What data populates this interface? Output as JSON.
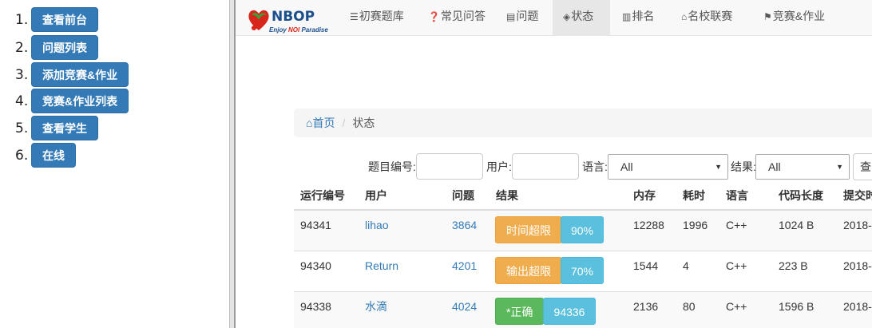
{
  "admin_menu": {
    "numbers": [
      "1.",
      "2.",
      "3.",
      "4.",
      "5.",
      "6."
    ],
    "items": [
      "查看前台",
      "问题列表",
      "添加竞赛&作业",
      "竞赛&作业列表",
      "查看学生",
      "在线"
    ]
  },
  "navbar": {
    "logo": {
      "brand": "NBOP",
      "tagline_pre": "Enjoy ",
      "tagline_noi": "NOI",
      "tagline_post": " Paradise"
    },
    "items": [
      {
        "icon": "list-icon",
        "glyph": "☰",
        "label": "初赛题库"
      },
      {
        "icon": "question-circle-icon",
        "glyph": "❓",
        "label": "常见问答"
      },
      {
        "icon": "list-alt-icon",
        "glyph": "▤",
        "label": "问题"
      },
      {
        "icon": "cube-icon",
        "glyph": "◈",
        "label": "状态"
      },
      {
        "icon": "bar-chart-icon",
        "glyph": "▥",
        "label": "排名"
      },
      {
        "icon": "bank-icon",
        "glyph": "⌂",
        "label": "名校联赛"
      },
      {
        "icon": "flag-icon",
        "glyph": "⚑",
        "label": "竞赛&作业"
      }
    ],
    "active_index": 3
  },
  "breadcrumb": {
    "home": "首页",
    "separator": "/",
    "current": "状态"
  },
  "filter": {
    "problem_id_label": "题目编号:",
    "user_label": "用户:",
    "language_label": "语言:",
    "language_value": "All",
    "result_label": "结果:",
    "result_value": "All",
    "query_label": "查"
  },
  "table": {
    "headers": [
      "运行编号",
      "用户",
      "问题",
      "结果",
      "内存",
      "耗时",
      "语言",
      "代码长度",
      "提交时"
    ],
    "rows": [
      {
        "run_id": "94341",
        "user": "lihao",
        "problem": "3864",
        "result": "时间超限",
        "result_color": "#f0ad4e",
        "score": "90%",
        "memory": "12288",
        "time": "1996",
        "language": "C++",
        "code_length": "1024 B",
        "submit_time": "2018-"
      },
      {
        "run_id": "94340",
        "user": "Return",
        "problem": "4201",
        "result": "输出超限",
        "result_color": "#f0ad4e",
        "score": "70%",
        "memory": "1544",
        "time": "4",
        "language": "C++",
        "code_length": "223 B",
        "submit_time": "2018-"
      },
      {
        "run_id": "94338",
        "user": "水滴",
        "problem": "4024",
        "result": "*正确",
        "result_color": "#5cb85c",
        "score": "94336",
        "memory": "2136",
        "time": "80",
        "language": "C++",
        "code_length": "1596 B",
        "submit_time": "2018-"
      }
    ]
  }
}
